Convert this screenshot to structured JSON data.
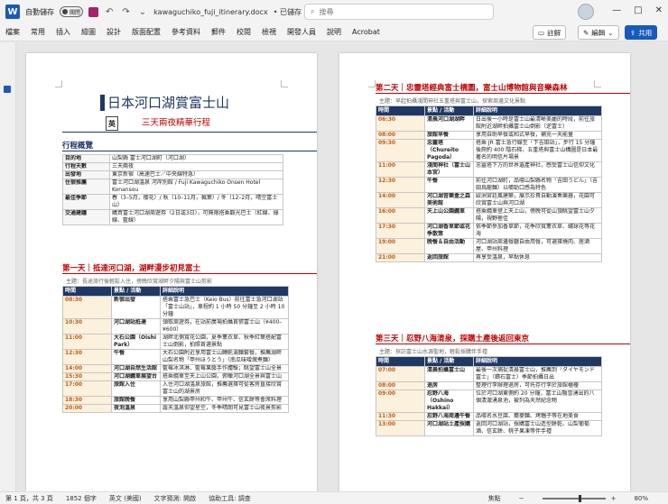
{
  "titlebar": {
    "autosave": "自動儲存",
    "autosave_state": "關閉",
    "filename": "kawaguchiko_fuji_itinerary.docx",
    "saved": "• 已儲存",
    "search_placeholder": "搜尋",
    "minimize": "—",
    "maximize": "□",
    "close": "✕"
  },
  "ribbon": {
    "tabs": [
      "檔案",
      "常用",
      "插入",
      "繪圖",
      "設計",
      "版面配置",
      "參考資料",
      "郵件",
      "校閱",
      "檢視",
      "開發人員",
      "說明",
      "Acrobat"
    ],
    "comment": "註解",
    "edit": "編輯",
    "share": "共用"
  },
  "doc": {
    "title": "日本河口湖賞富士山",
    "subtitle": "三天兩夜精華行程",
    "lang_box": "英",
    "overview_heading": "行程概覽",
    "overview": [
      [
        "目的地",
        "山梨縣 富士河口湖町（河口湖）"
      ],
      [
        "行程天數",
        "三天兩夜"
      ],
      [
        "出發地",
        "東京新宿（高速巴士／中央線特急）"
      ],
      [
        "住宿推薦",
        "富士河口湖溫泉 河岸別館 / Fuji Kawaguchiko Onsen Hotel Konansou"
      ],
      [
        "最佳季節",
        "春（3–5月，櫻花）/ 秋（10–11月，楓葉）/ 冬（12–2月，晴空富士山）"
      ],
      [
        "交通建議",
        "購買富士河口湖周遊券（2日或3日），可無限搭乘觀光巴士（紅線、綠線、藍線）"
      ]
    ],
    "headers": [
      "時間",
      "景點 / 活動",
      "詳細說明"
    ],
    "day1_heading": "第一天｜抵達河口湖，湖畔漫步初見富士",
    "day1_theme": "主題：長途旅行後輕鬆入住，傍晚欣賞湖畔夕陽與富士山剪影",
    "day1": [
      [
        "08:30",
        "新宿出發",
        "搭乘富士急巴士（Keio Bus）前往富士急河口湖站「富士山站」，車程約 1 小時 50 分鐘至 2 小時 10 分鐘"
      ],
      [
        "10:30",
        "河口湖站抵達",
        "領取周遊券，在站前廣場拍攝首張富士山（¥400–¥600）"
      ],
      [
        "11:00",
        "大石公園（Oishi Park）",
        "湖畔北側賞花公園，夏季薰衣草、秋季紅葉搭配富士山倒影，拍照首選景點"
      ],
      [
        "12:30",
        "午餐",
        "大石公園附近享用富士山餺飥湯麵套餐，推薦湖畔山梨名物「甲州ほうとう」（南瓜味噌燉煮麵）"
      ],
      [
        "14:00",
        "河口湖自然生活館",
        "藍莓冰淇淋、藍莓果醬手作體驗；眺望富士山全景"
      ],
      [
        "15:30",
        "河口湖纜車展望台",
        "搭乘纜車至天上山公園，俯瞰河口湖全景與富士山"
      ],
      [
        "17:00",
        "旅館入住",
        "入住河口湖溫泉旅館，推薦選擇可從客房直接欣賞富士山的湖景房"
      ],
      [
        "18:30",
        "旅館晚餐",
        "享用山梨縣甲州和牛、甲州牛、信玄餅等會席料理"
      ],
      [
        "20:00",
        "夜泡溫泉",
        "露天溫泉仰望星空，冬季晴朗可見富士山夜景剪影"
      ]
    ],
    "day2_heading": "第二天｜忠靈塔經典富士構圖，富士山博物館與音樂森林",
    "day2_theme": "主題：早起拍攝淺間神社五重塔與富士山，探索周邊文化景點",
    "day2": [
      [
        "06:30",
        "清晨河口湖湖畔",
        "日出後一小時是富士山最清晰美麗的時段，前往旅館附近湖畔拍攝富士山倒影（逆富士）"
      ],
      [
        "08:00",
        "旅館早餐",
        "享用自助早餐或和式早餐，補充一天能量"
      ],
      [
        "09:30",
        "忠靈塔（Chureito Pagoda）",
        "搭乘 JR 富士急行線至「下吉田站」，步行 15 分鐘後爬約 400 階石梯，五重塔與富士山構圖是日本最著名的明信片場景"
      ],
      [
        "11:00",
        "淺間神社（富士山本宮）",
        "忠靈塔下方的世界遺產神社，感受富士山信仰文化"
      ],
      [
        "12:30",
        "午餐",
        "前往河口湖町，品嚐山梨縣名物「吉田うどん」（吉田烏龍麵）以嚼勁口感為特色"
      ],
      [
        "14:00",
        "河口湖音樂盒之森美術館",
        "歐洲宮廷風建築，展示珍貴自動演奏樂器，花園可欣賞富士山與河口湖"
      ],
      [
        "16:00",
        "天上山公園纜車",
        "搭乘纜車登上天上山，傍晚可從山頂眺望富士山夕陽，視野極佳"
      ],
      [
        "17:30",
        "河口湖香草節或花季散策",
        "依季節參加香草節，花季欣賞薰衣草、繡球花等花海"
      ],
      [
        "19:00",
        "晚餐＆自由活動",
        "河口湖站周邊餐廳自由用餐，可選擇燒肉、居酒屋、甲州料理"
      ],
      [
        "21:00",
        "返回旅館",
        "再享受溫泉，早點休息"
      ]
    ],
    "day3_heading": "第三天｜忍野八海清泉，採購土產後返回東京",
    "day3_theme": "主題：探訪富士山水源聖地，輕鬆採購伴手禮",
    "day3": [
      [
        "07:00",
        "清晨拍攝富士山",
        "最後一次捕捉清晨富士山，推薦到「ダイヤモンド富士」（鑽石富士）季節拍攝日出"
      ],
      [
        "08:00",
        "退房",
        "整理行李辦理退房，可托存行李於旅館櫃檯"
      ],
      [
        "09:00",
        "忍野八海（Oshino Hakkai）",
        "位於河口湖東側約 20 分鐘，富士山融雪湧出的八個清澈湧泉池，被列為天然紀念物"
      ],
      [
        "11:30",
        "忍野八海周邊午餐",
        "品嚐名水豆腐、蕎麥麵、烤糰子等在地美食"
      ],
      [
        "13:00",
        "河口湖站土產採購",
        "返回河口湖站，採購富士山造型餅乾、山梨葡萄酒、信玄餅、桃子果凍等伴手禮"
      ]
    ]
  },
  "status": {
    "page": "第 1 頁，共 3 頁",
    "words": "1852 個字",
    "lang": "英文 (美國)",
    "predict": "文字預測: 開啟",
    "access": "協助工具: 調查",
    "focus": "焦點",
    "zoom": "80%"
  }
}
